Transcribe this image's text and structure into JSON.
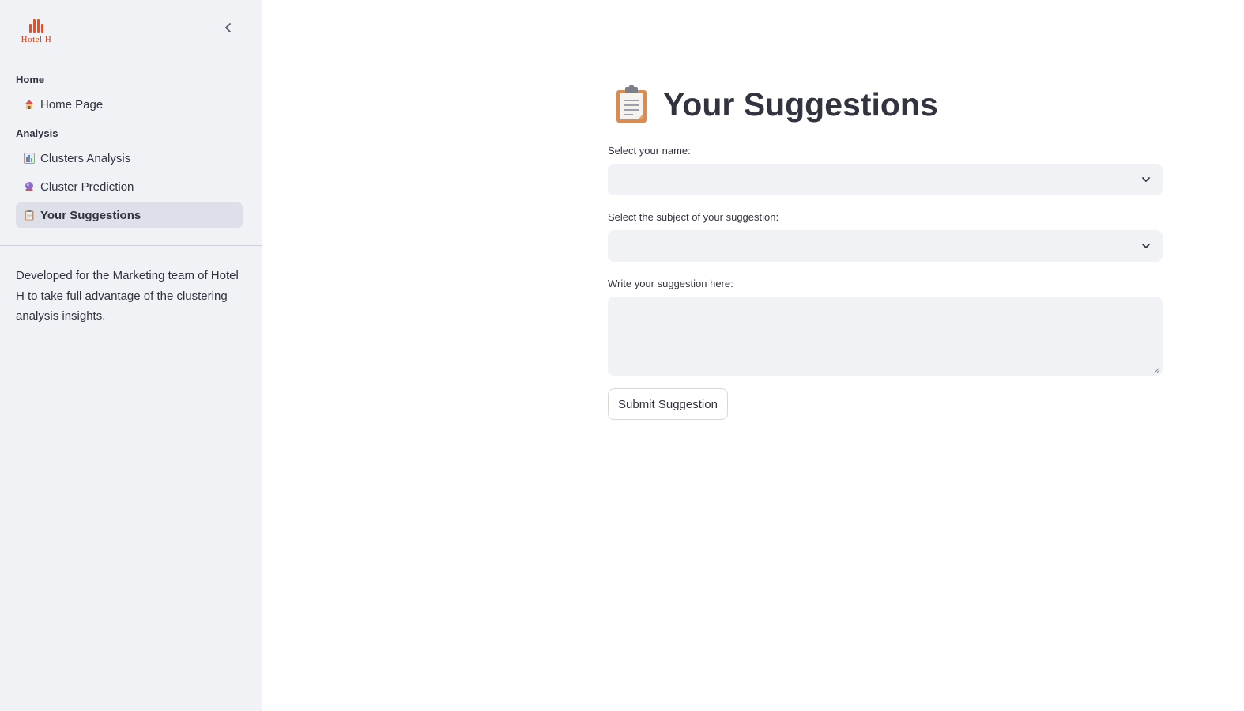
{
  "app": {
    "logo_text": "Hotel H",
    "collapse_icon": "chevron-left-icon"
  },
  "sidebar": {
    "sections": [
      {
        "label": "Home",
        "items": [
          {
            "label": "Home Page",
            "icon": "house-icon",
            "active": false
          }
        ]
      },
      {
        "label": "Analysis",
        "items": [
          {
            "label": "Clusters Analysis",
            "icon": "bar-chart-icon",
            "active": false
          },
          {
            "label": "Cluster Prediction",
            "icon": "crystal-ball-icon",
            "active": false
          },
          {
            "label": "Your Suggestions",
            "icon": "clipboard-icon",
            "active": true
          }
        ]
      }
    ],
    "note": "Developed for the Marketing team of Hotel H to take full advantage of the clustering analysis insights."
  },
  "main": {
    "title": "Your Suggestions",
    "title_icon": "clipboard-icon",
    "name_label": "Select your name:",
    "name_value": "",
    "subject_label": "Select the subject of your suggestion:",
    "subject_value": "",
    "suggestion_label": "Write your suggestion here:",
    "suggestion_value": "",
    "submit_label": "Submit Suggestion"
  },
  "colors": {
    "sidebar_bg": "#f0f2f6",
    "active_item_bg": "#dde0e8",
    "input_bg": "#f0f2f6",
    "text": "#31333f",
    "logo_accent": "#e0512b"
  }
}
